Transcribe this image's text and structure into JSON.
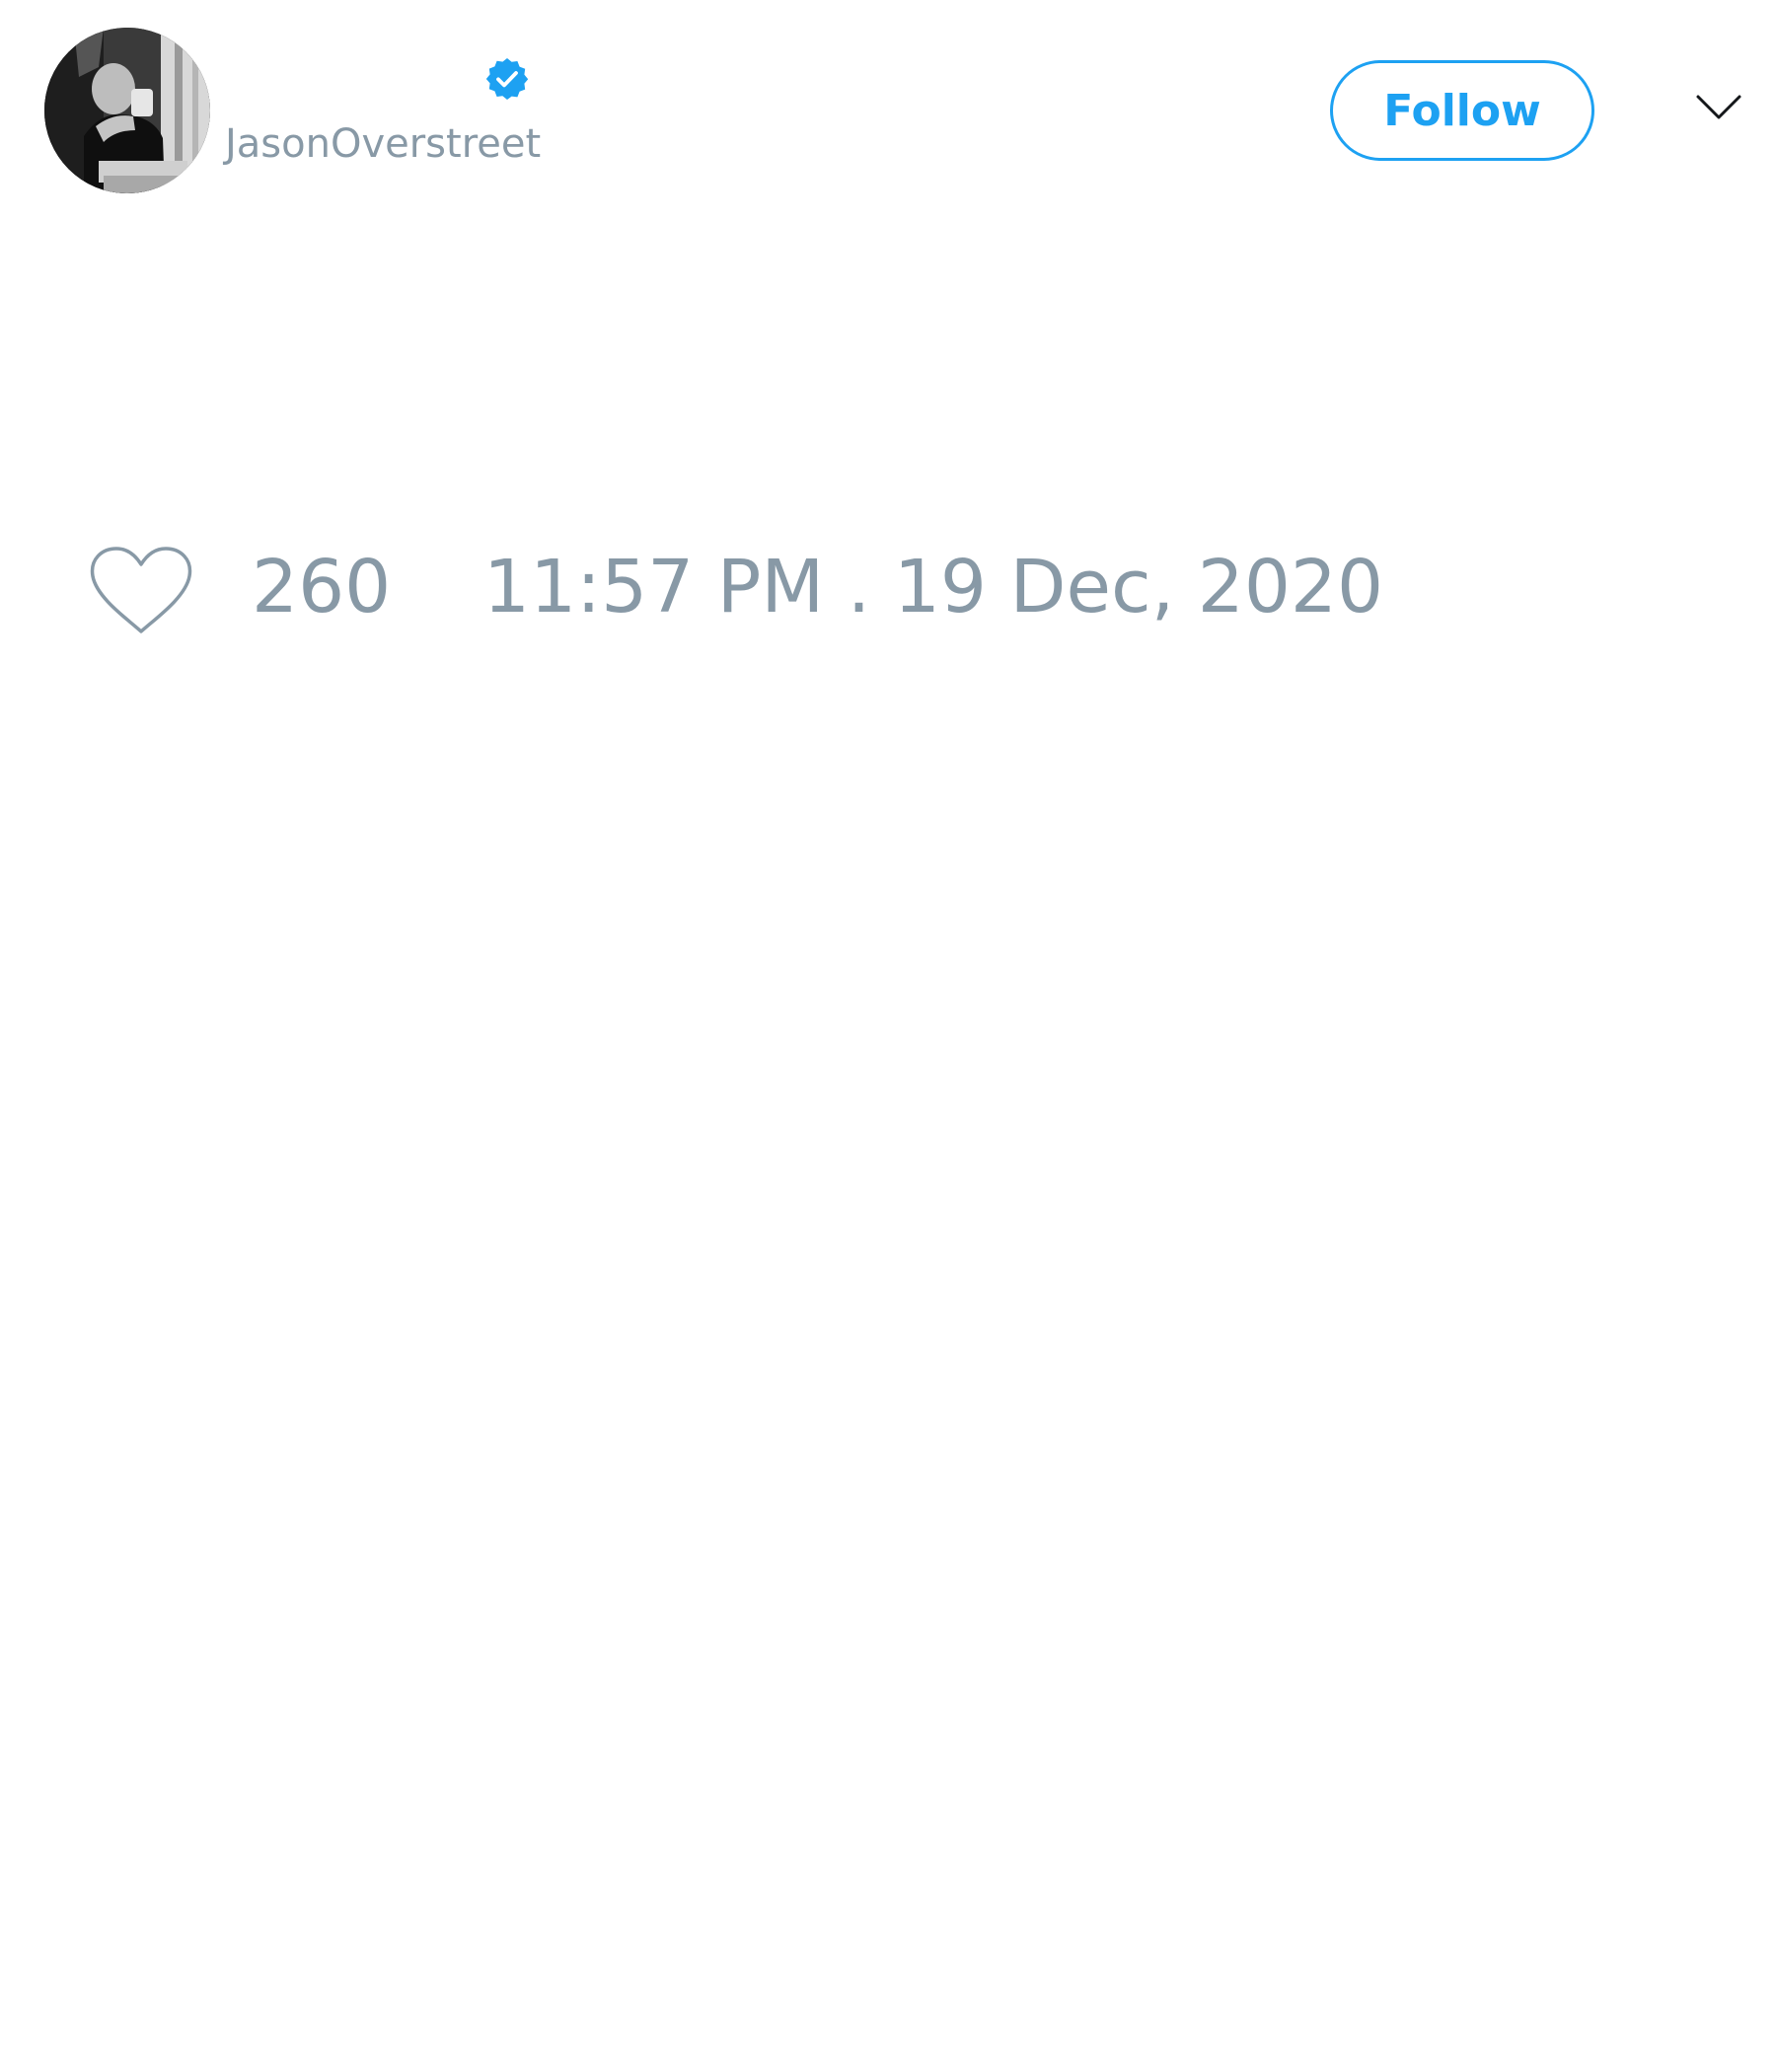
{
  "tweet": {
    "author": {
      "handle": "JasonOverstreet",
      "verified": true,
      "avatar_icon": "user-avatar-photo"
    },
    "actions": {
      "follow_label": "Follow",
      "more_menu_icon": "chevron-down-icon"
    },
    "stats": {
      "like_icon": "heart-icon",
      "like_count": "260",
      "timestamp": "11:57 PM . 19 Dec, 2020"
    }
  },
  "colors": {
    "accent": "#1da1f2",
    "muted_text": "#8899a6",
    "background": "#ffffff"
  }
}
